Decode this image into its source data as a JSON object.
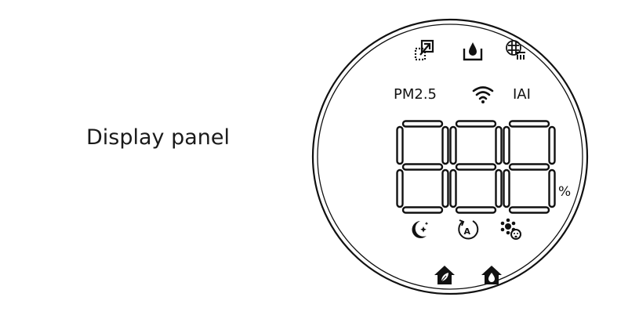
{
  "caption": "Display panel",
  "readings": {
    "pm_label": "PM2.5",
    "index_label": "IAI",
    "digits": "888",
    "unit": "%"
  },
  "icons": {
    "top_row": [
      "filter-replace-icon",
      "water-tank-icon",
      "filter-clean-icon"
    ],
    "status_row": [
      "wifi-icon"
    ],
    "mode_row": [
      "sleep-mode-icon",
      "auto-mode-icon",
      "allergen-mode-icon"
    ],
    "bottom_row": [
      "home-purify-icon",
      "home-humidify-icon"
    ]
  },
  "colors": {
    "foreground": "#111111",
    "background": "#ffffff"
  }
}
